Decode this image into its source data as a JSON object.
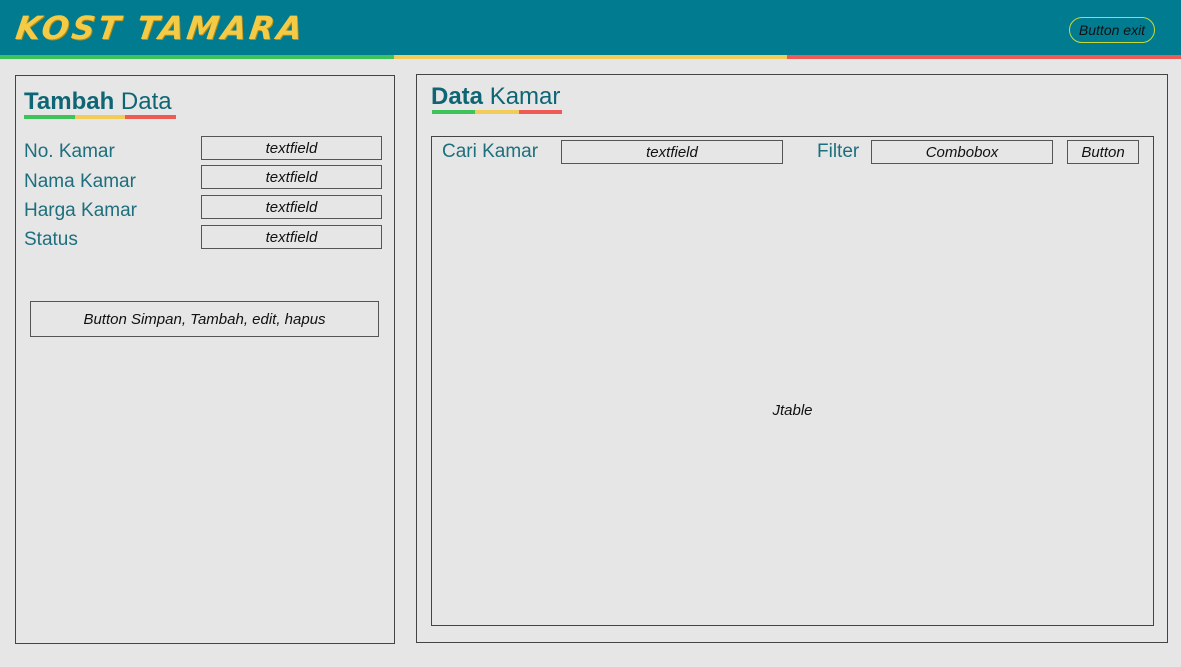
{
  "header": {
    "logo_text": "KOST TAMARA",
    "exit_button": "Button exit",
    "colors": {
      "bar": "#007b8f",
      "logo": "#f3cb46",
      "green": "#3ec35a",
      "yellow": "#f1cc58",
      "red": "#ee5b55"
    }
  },
  "left_panel": {
    "title_bold": "Tambah",
    "title_light": "Data",
    "fields": [
      {
        "label": "No. Kamar",
        "value": "textfield"
      },
      {
        "label": "Nama Kamar",
        "value": "textfield"
      },
      {
        "label": "Harga Kamar",
        "value": "textfield"
      },
      {
        "label": "Status",
        "value": "textfield"
      }
    ],
    "action_button": "Button Simpan, Tambah, edit, hapus"
  },
  "right_panel": {
    "title_bold": "Data",
    "title_light": "Kamar",
    "search_label": "Cari Kamar",
    "search_value": "textfield",
    "filter_label": "Filter",
    "filter_value": "Combobox",
    "filter_button": "Button",
    "table_placeholder": "Jtable"
  }
}
